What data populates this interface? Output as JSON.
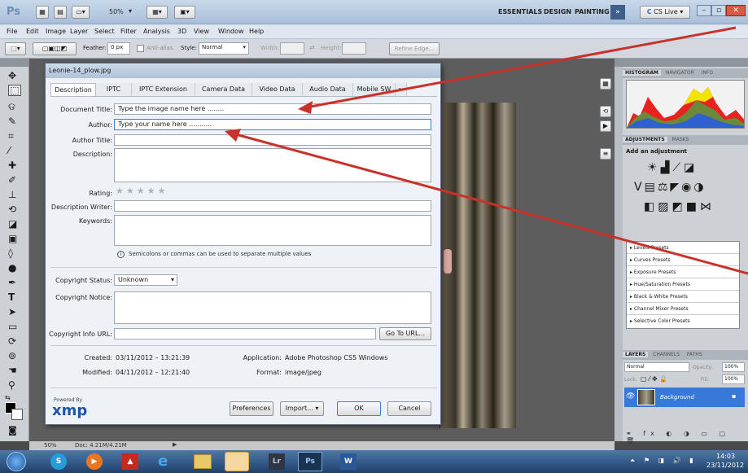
{
  "app": {
    "logo": "Ps",
    "zoom": "50%",
    "workspaces": [
      "ESSENTIALS",
      "DESIGN",
      "PAINTING"
    ],
    "cslive": "CS Live"
  },
  "menu": [
    "File",
    "Edit",
    "Image",
    "Layer",
    "Select",
    "Filter",
    "Analysis",
    "3D",
    "View",
    "Window",
    "Help"
  ],
  "options": {
    "feather_label": "Feather:",
    "feather_value": "0 px",
    "antialias": "Anti-alias",
    "style_label": "Style:",
    "style_value": "Normal",
    "width_label": "Width:",
    "height_label": "Height:",
    "refine": "Refine Edge..."
  },
  "dialog": {
    "title": "Leonie-14_plow.jpg",
    "tabs": [
      "Description",
      "IPTC",
      "IPTC Extension",
      "Camera Data",
      "Video Data",
      "Audio Data",
      "Mobile SW"
    ],
    "labels": {
      "doc_title": "Document Title:",
      "author": "Author:",
      "author_title": "Author Title:",
      "description": "Description:",
      "rating": "Rating:",
      "desc_writer": "Description Writer:",
      "keywords": "Keywords:",
      "copyright_status": "Copyright Status:",
      "copyright_notice": "Copyright Notice:",
      "copyright_url": "Copyright Info URL:",
      "created": "Created:",
      "modified": "Modified:",
      "application": "Application:",
      "format": "Format:"
    },
    "values": {
      "doc_title": "Type the image name here ........",
      "author": "Type your name here ...........",
      "copyright_status": "Unknown",
      "created": "03/11/2012 – 13:21:39",
      "modified": "04/11/2012 – 12:21:40",
      "application": "Adobe Photoshop CS5 Windows",
      "format": "image/jpeg"
    },
    "keywords_hint": "Semicolons or commas can be used to separate multiple values",
    "goto_url": "Go To URL...",
    "powered_by": "Powered By",
    "xmp": "xmp",
    "buttons": {
      "preferences": "Preferences",
      "import": "Import...",
      "ok": "OK",
      "cancel": "Cancel"
    }
  },
  "panels": {
    "tabs_top": [
      "HISTOGRAM",
      "NAVIGATOR",
      "INFO"
    ],
    "tabs_adj": [
      "ADJUSTMENTS",
      "MASKS"
    ],
    "add_adjustment": "Add an adjustment",
    "presets": [
      "Levels Presets",
      "Curves Presets",
      "Exposure Presets",
      "Hue/Saturation Presets",
      "Black & White Presets",
      "Channel Mixer Presets",
      "Selective Color Presets"
    ],
    "tabs_layers": [
      "LAYERS",
      "CHANNELS",
      "PATHS"
    ],
    "blend": "Normal",
    "opacity_label": "Opacity:",
    "opacity": "100%",
    "lock_label": "Lock:",
    "fill_label": "Fill:",
    "fill": "100%",
    "layer_name": "Background"
  },
  "status": {
    "zoom": "50%",
    "doc": "Doc: 4.21M/4.21M"
  },
  "taskbar": {
    "time": "14:03",
    "date": "23/11/2012"
  }
}
